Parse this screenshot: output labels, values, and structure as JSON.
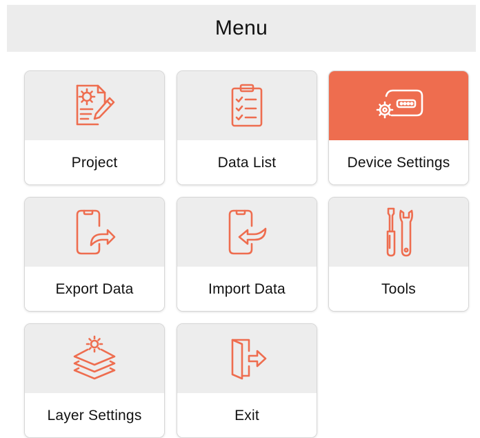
{
  "header": {
    "title": "Menu"
  },
  "colors": {
    "accent": "#ee6d4f",
    "tile_background": "#ededed",
    "header_background": "#ececec"
  },
  "menu": {
    "items": [
      {
        "label": "Project",
        "icon": "project-settings-icon",
        "active": false
      },
      {
        "label": "Data List",
        "icon": "clipboard-list-icon",
        "active": false
      },
      {
        "label": "Device Settings",
        "icon": "device-gear-icon",
        "active": true
      },
      {
        "label": "Export Data",
        "icon": "phone-export-icon",
        "active": false
      },
      {
        "label": "Import Data",
        "icon": "phone-import-icon",
        "active": false
      },
      {
        "label": "Tools",
        "icon": "screwdriver-wrench-icon",
        "active": false
      },
      {
        "label": "Layer Settings",
        "icon": "layers-gear-icon",
        "active": false
      },
      {
        "label": "Exit",
        "icon": "door-exit-icon",
        "active": false
      }
    ]
  }
}
